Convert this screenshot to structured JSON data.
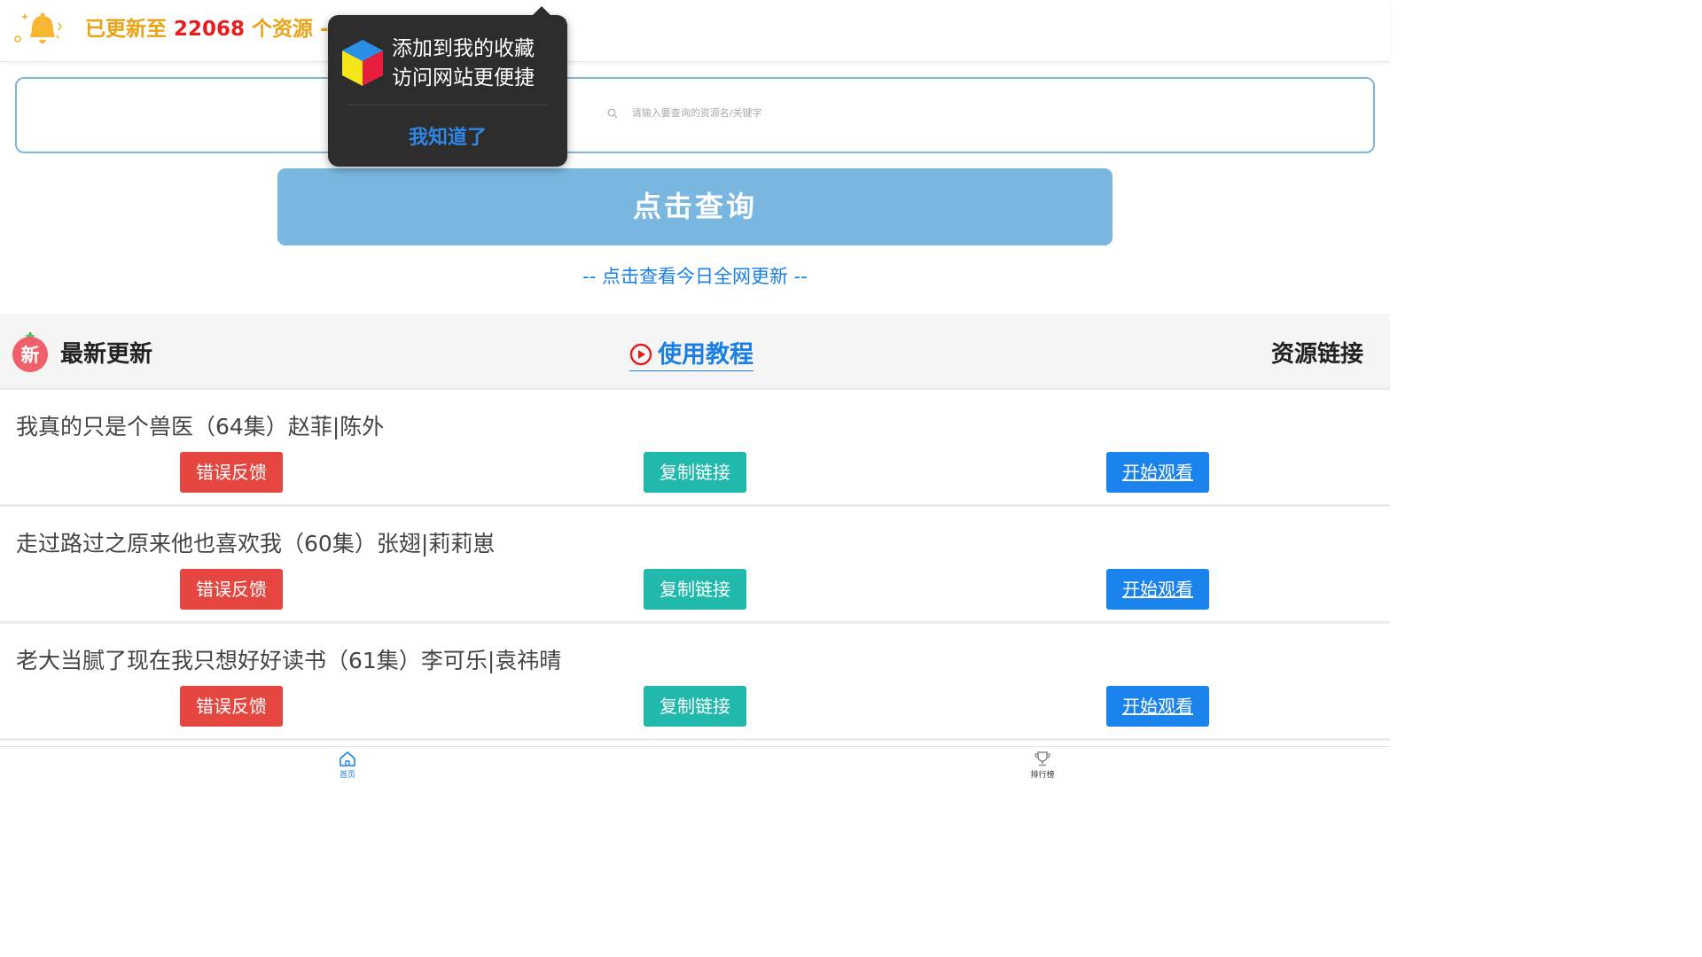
{
  "topbar": {
    "notice_prefix": "已更新至 ",
    "notice_count": "22068",
    "notice_suffix": " 个资源 -- 点击保存到网盘进行观看",
    "icon": "bell-icon"
  },
  "search": {
    "placeholder": "请输入要查询的资源名/关键字",
    "icon": "search-icon"
  },
  "query_button": "点击查询",
  "today_link": "-- 点击查看今日全网更新 --",
  "section": {
    "badge_text": "新",
    "latest_title": "最新更新",
    "tutorial_label": "使用教程",
    "resource_link_title": "资源链接"
  },
  "rows": [
    {
      "title": "我真的只是个兽医（64集）赵菲|陈外",
      "feedback": "错误反馈",
      "copy": "复制链接",
      "watch": "开始观看"
    },
    {
      "title": "走过路过之原来他也喜欢我（60集）张翅|莉莉崽",
      "feedback": "错误反馈",
      "copy": "复制链接",
      "watch": "开始观看"
    },
    {
      "title": "老大当腻了现在我只想好好读书（61集）李可乐|袁祎晴",
      "feedback": "错误反馈",
      "copy": "复制链接",
      "watch": "开始观看"
    }
  ],
  "tabbar": {
    "home_label": "首页",
    "rank_label": "排行榜"
  },
  "popup": {
    "line1": "添加到我的收藏",
    "line2": "访问网站更便捷",
    "button": "我知道了"
  },
  "colors": {
    "accent_blue": "#1a80e6",
    "query_button_bg": "#79b7e1",
    "notice_orange": "#e8a316",
    "count_red": "#e81e1e",
    "feedback_red": "#e5463f",
    "copy_teal": "#20b9ac",
    "watch_blue": "#1b84ec"
  }
}
